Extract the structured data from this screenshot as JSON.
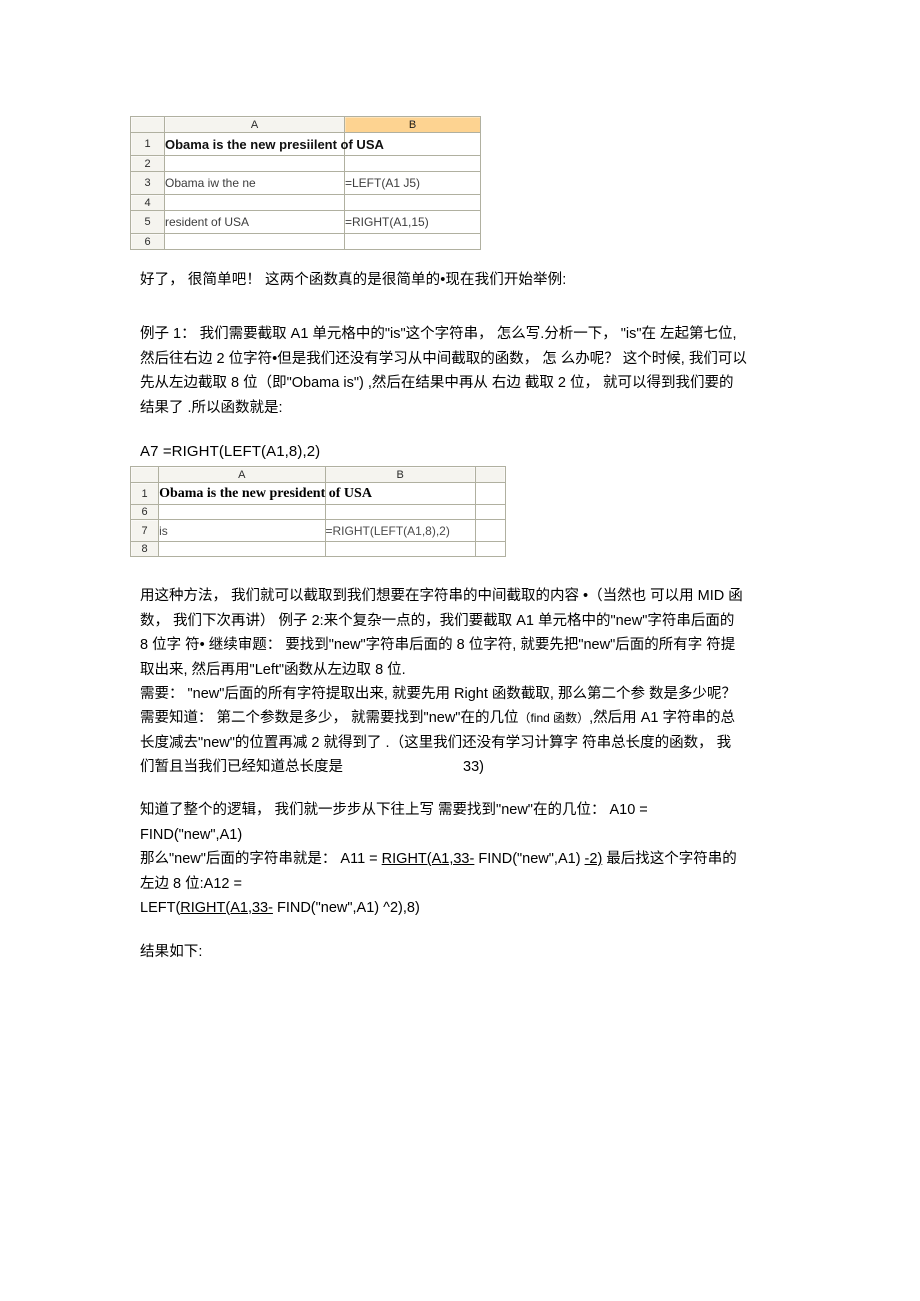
{
  "document": {
    "language": "zh-CN",
    "tables": [
      {
        "name": "excel-table-1",
        "columns": [
          "A",
          "B"
        ],
        "selected_column": "B",
        "rows": [
          {
            "num": "1",
            "a": "Obama is the new presiilent of USA",
            "b": "",
            "bold": true
          },
          {
            "num": "2",
            "a": "",
            "b": ""
          },
          {
            "num": "3",
            "a": "Obama iw the ne",
            "b": "=LEFT(A1 J5)"
          },
          {
            "num": "4",
            "a": "",
            "b": ""
          },
          {
            "num": "5",
            "a": "resident of USA",
            "b": "=RIGHT(A1,15)"
          },
          {
            "num": "6",
            "a": "",
            "b": ""
          }
        ]
      },
      {
        "name": "excel-table-2",
        "columns": [
          "A",
          "B",
          ""
        ],
        "selected_column": "",
        "rows": [
          {
            "num": "1",
            "a": "Obama is the new president of USA",
            "b": "",
            "bold": true
          },
          {
            "num": "6",
            "a": "",
            "b": ""
          },
          {
            "num": "7",
            "a": "is",
            "b": "=RIGHT(LEFT(A1,8),2)"
          },
          {
            "num": "8",
            "a": "",
            "b": ""
          }
        ]
      }
    ],
    "paragraphs": {
      "intro": "好了， 很简单吧！ 这两个函数真的是很简单的•现在我们开始举例:",
      "example1_line1": "例子 1： 我们需要截取 A1 单元格中的\"is\"这个字符串， 怎么写.分析一下， \"is\"在 左起第七位,",
      "example1_line2": "然后往右边 2 位字符•但是我们还没有学习从中间截取的函数， 怎 么办呢？ 这个时候, 我们可以",
      "example1_line3": "先从左边截取 8 位（即\"Obama is\") ,然后在结果中再从 右边 截取 2 位， 就可以得到我们要的",
      "example1_line4": "结果了 .所以函数就是:",
      "formula_a7": "A7 =RIGHT(LEFT(A1,8),2)",
      "example2_line1": "用这种方法， 我们就可以截取到我们想要在字符串的中间截取的内容 •（当然也 可以用 MID 函",
      "example2_line2_pre": "数， 我们下次再讲） 例子 2:来个复杂一点的，我们要截取 A1 单元格中的\"new\"字符串后面的",
      "example2_line3": "8 位字 符• 继续审题： 要找到\"new\"字符串后面的 8 位字符, 就要先把\"new\"后面的所有字 符提",
      "example2_line4": "取出来, 然后再用\"Left\"函数从左边取 8 位.",
      "example2_line5": "需要： \"new\"后面的所有字符提取出来, 就要先用 Right 函数截取, 那么第二个参 数是多少呢？",
      "example2_line6_a": "需要知道： 第二个参数是多少， 就需要找到\"new\"在的几位",
      "example2_line6_b": "（find 函数）",
      "example2_line6_c": ",然后用 A1 字符串的总",
      "example2_line7": "长度减去\"new\"的位置再减 2 就得到了 .（这里我们还没有学习计算字 符串总长度的函数， 我",
      "example2_line8_a": "们暂且当我们已经知道总长度是",
      "example2_line8_b": "33)",
      "logic_line1": "知道了整个的逻辑， 我们就一步步从下往上写 需要找到\"new\"在的几位： A10 =",
      "logic_line2": "FIND(\"new\",A1)",
      "logic_line3_a": "那么\"new\"后面的字符串就是： A11 = ",
      "logic_line3_u1": "RIGHT(A1,33-",
      "logic_line3_b": " FIND(\"new\",A1) ",
      "logic_line3_u2": "-2)",
      "logic_line3_c": " 最后找这个字符串的",
      "logic_line4": "左边 8 位:A12 =",
      "logic_line5_a": "LEFT(",
      "logic_line5_u": "RIGHT(A1,33-",
      "logic_line5_b": " FIND(\"new\",A1) ^2),8)",
      "result_label": "结果如下:"
    },
    "colors": {
      "selected_header": "#fbb03b",
      "header_background": "#e8e6da",
      "grid_line": "#b0b0a0",
      "text": "#000000",
      "cell_text": "#3d3d3d"
    }
  }
}
